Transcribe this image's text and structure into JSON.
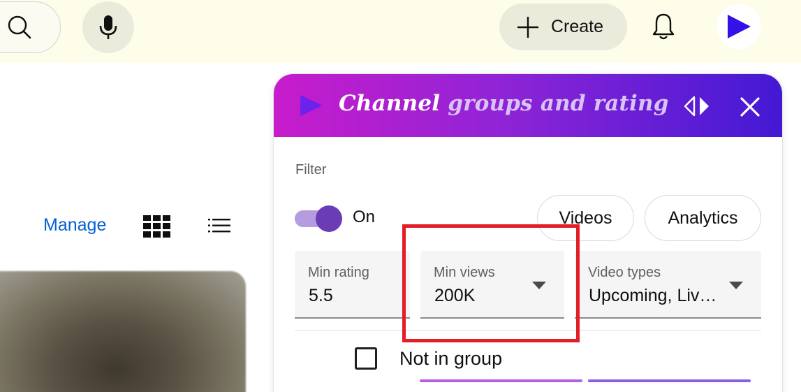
{
  "topbar": {
    "search_icon": "search-icon",
    "mic_icon": "microphone-icon",
    "create_label": "Create",
    "bell_icon": "bell-icon",
    "avatar_icon": "play-icon"
  },
  "page": {
    "manage_label": "Manage",
    "grid_icon": "grid-view-icon",
    "list_icon": "list-view-icon"
  },
  "panel": {
    "title_part1": "Channel",
    "title_part2": "groups and rating",
    "filter_label": "Filter",
    "toggle_label": "On",
    "toggle_on": true,
    "videos_label": "Videos",
    "analytics_label": "Analytics",
    "min_rating_label": "Min rating",
    "min_rating_value": "5.5",
    "min_views_label": "Min views",
    "min_views_value": "200K",
    "video_types_label": "Video types",
    "video_types_value": "Upcoming, Liv…",
    "not_in_group_label": "Not in group",
    "accent_start": "#c81ccb",
    "accent_end": "#4319d4"
  },
  "highlight_color": "#e41e26"
}
